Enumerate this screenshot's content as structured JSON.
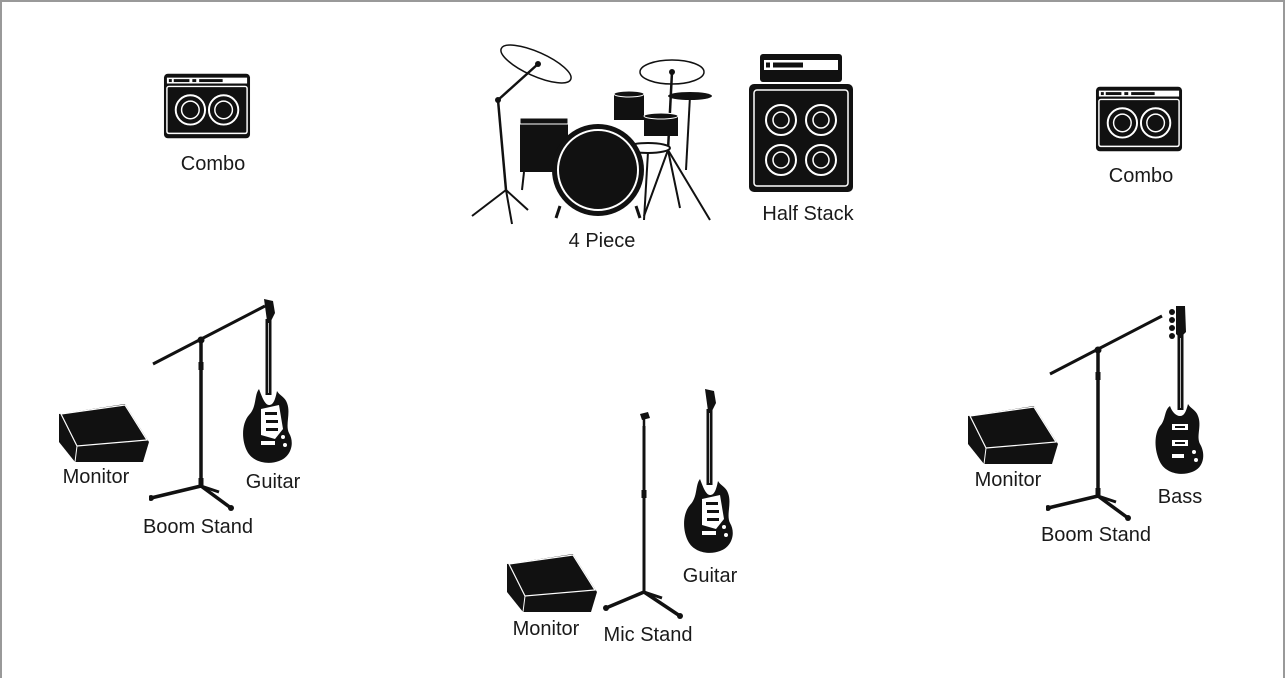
{
  "stage_plot": {
    "border_color": "#999999",
    "items": [
      {
        "id": "combo-left",
        "kind": "combo-amp",
        "label": "Combo"
      },
      {
        "id": "drum-kit",
        "kind": "drum-kit",
        "label": "4 Piece"
      },
      {
        "id": "half-stack",
        "kind": "half-stack",
        "label": "Half Stack"
      },
      {
        "id": "combo-right",
        "kind": "combo-amp",
        "label": "Combo"
      },
      {
        "id": "monitor-left",
        "kind": "wedge-monitor",
        "label": "Monitor"
      },
      {
        "id": "boom-stand-left",
        "kind": "boom-mic-stand",
        "label": "Boom Stand"
      },
      {
        "id": "guitar-left",
        "kind": "electric-guitar",
        "label": "Guitar"
      },
      {
        "id": "monitor-center",
        "kind": "wedge-monitor",
        "label": "Monitor"
      },
      {
        "id": "mic-stand-center",
        "kind": "straight-mic-stand",
        "label": "Mic Stand"
      },
      {
        "id": "guitar-center",
        "kind": "electric-guitar",
        "label": "Guitar"
      },
      {
        "id": "monitor-right",
        "kind": "wedge-monitor",
        "label": "Monitor"
      },
      {
        "id": "boom-stand-right",
        "kind": "boom-mic-stand",
        "label": "Boom Stand"
      },
      {
        "id": "bass-right",
        "kind": "bass-guitar",
        "label": "Bass"
      }
    ]
  }
}
